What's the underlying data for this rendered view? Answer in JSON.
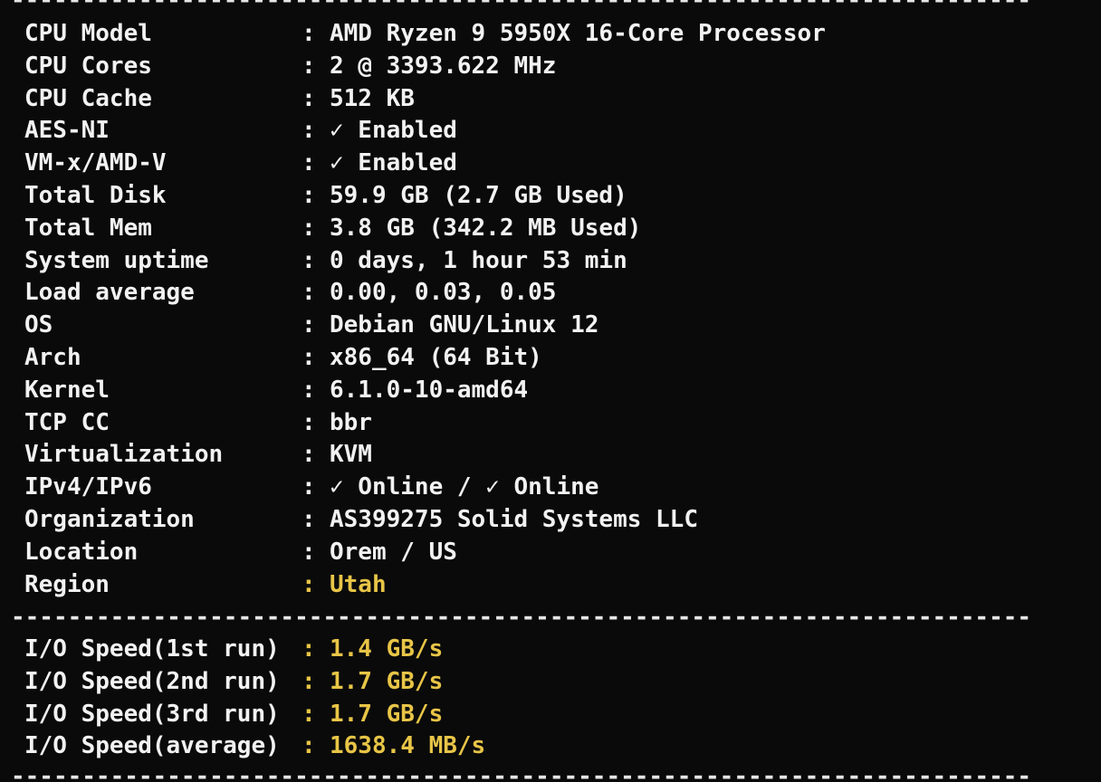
{
  "separator": "--------------------------------------------------------------------------------------------------",
  "colon": ":",
  "system_info": [
    {
      "key": "CPU Model",
      "value": "AMD Ryzen 9 5950X 16-Core Processor"
    },
    {
      "key": "CPU Cores",
      "value": "2 @ 3393.622 MHz"
    },
    {
      "key": "CPU Cache",
      "value": "512 KB"
    },
    {
      "key": "AES-NI",
      "value": "✓ Enabled"
    },
    {
      "key": "VM-x/AMD-V",
      "value": "✓ Enabled"
    },
    {
      "key": "Total Disk",
      "value": "59.9 GB (2.7 GB Used)"
    },
    {
      "key": "Total Mem",
      "value": "3.8 GB (342.2 MB Used)"
    },
    {
      "key": "System uptime",
      "value": "0 days, 1 hour 53 min"
    },
    {
      "key": "Load average",
      "value": "0.00, 0.03, 0.05"
    },
    {
      "key": "OS",
      "value": "Debian GNU/Linux 12"
    },
    {
      "key": "Arch",
      "value": "x86_64 (64 Bit)"
    },
    {
      "key": "Kernel",
      "value": "6.1.0-10-amd64"
    },
    {
      "key": "TCP CC",
      "value": "bbr"
    },
    {
      "key": "Virtualization",
      "value": "KVM"
    },
    {
      "key": "IPv4/IPv6",
      "value": "✓ Online / ✓ Online"
    },
    {
      "key": "Organization",
      "value": "AS399275 Solid Systems LLC"
    },
    {
      "key": "Location",
      "value": "Orem / US"
    },
    {
      "key": "Region",
      "value": "Utah"
    }
  ],
  "io_speed": [
    {
      "key": "I/O Speed(1st run)",
      "value": "1.4 GB/s"
    },
    {
      "key": "I/O Speed(2nd run)",
      "value": "1.7 GB/s"
    },
    {
      "key": "I/O Speed(3rd run)",
      "value": "1.7 GB/s"
    },
    {
      "key": "I/O Speed(average)",
      "value": "1638.4 MB/s"
    }
  ],
  "colors": {
    "background": "#0a0a0a",
    "text": "#f2f2f2",
    "highlight": "#e8c547"
  }
}
